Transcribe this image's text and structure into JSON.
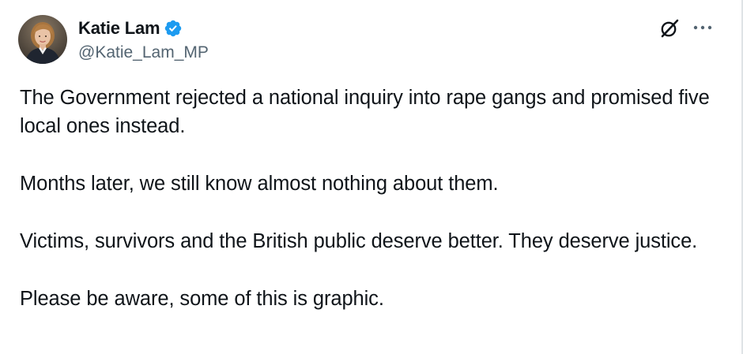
{
  "author": {
    "display_name": "Katie Lam",
    "handle": "@Katie_Lam_MP",
    "verified": true,
    "avatar_icon": "avatar-photo"
  },
  "actions": {
    "grok_icon": "grok-icon",
    "more_icon": "more-horizontal-icon"
  },
  "tweet": {
    "paragraphs": [
      "The Government rejected a national inquiry into rape gangs and promised five local ones instead.",
      "Months later, we still know almost nothing about them.",
      "Victims, survivors and the British public deserve better. They deserve justice.",
      "Please be aware, some of this is graphic."
    ]
  },
  "colors": {
    "verified_blue": "#1d9bf0",
    "text": "#0f1419",
    "secondary_text": "#536471"
  }
}
